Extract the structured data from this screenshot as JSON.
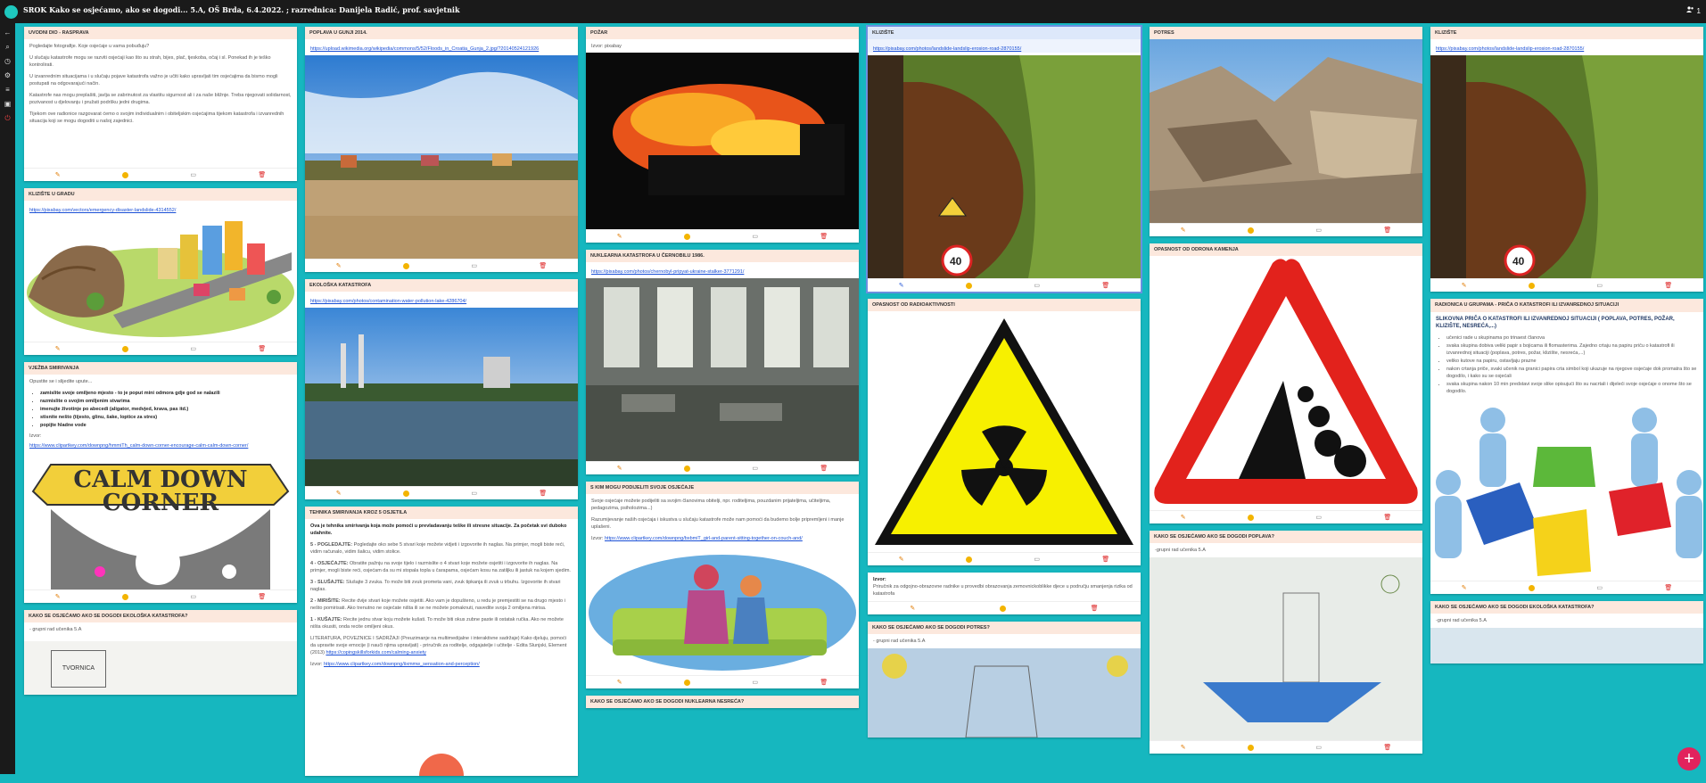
{
  "header": {
    "title": "SROK Kako se osjećamo, ako se dogodi... 5.A, OŠ Brda, 6.4.2022. ; razrednica: Danijela Radić, prof. savjetnik",
    "member_count": "1"
  },
  "sidebar": {
    "icons": [
      "back-arrow-icon",
      "search-icon",
      "clock-icon",
      "settings-icon",
      "sort-icon",
      "layout-icon",
      "power-icon"
    ]
  },
  "cards": {
    "uvodni": {
      "title": "UVODNI DIO - RASPRAVA",
      "p1": "Pogledajte fotografije. Koje osjećaje u vama pobuđuju?",
      "p2": "U slučaju katastrofe mogu se razviti osjećaji kao što su strah, bijes, plač, tjeskoba, očaj i sl. Ponekad ih je teško kontrolirati.",
      "p3": "U izvanrednim situacijama i u slučaju pojave katastrofa važno je učiti kako upravljati tim osjećajima da bismo mogli postupati na odgovarajući način.",
      "p4": "Katastrofe nas mogu preplašiti, javlja se zabrinutost za vlastitu sigurnost ali i za naše bližnje. Treba njegovati solidarnost, pozivanost u djelovanju i pružati podršku jedni drugima.",
      "p5": "Tijekom ove radionice razgovarat ćemo o svojim individualnim i obiteljskim osjećajima tijekom katastrofa i izvanrednih situacija koji se mogu dogoditi u našoj zajednici."
    },
    "kliziste_gradu": {
      "title": "KLIZIŠTE U GRADU",
      "link": "https://pixabay.com/vectors/emergency-disaster-landslide-4314552/"
    },
    "vjezba": {
      "title": "VJEŽBA SMIRIVANJA",
      "intro": "Opustite se i slijedite upute...",
      "items": [
        "zamislite svoje omiljeno mjesto - to je poput mini odmora gdje god se nalazili",
        "razmislite o svojim omiljenim stvarima",
        "imenujte životinje po abecedi (aligator, medvjed, krava, pas itd.)",
        "stisnite nešto (tijesto, glinu, šake, loptice za stres)",
        "popijte hladne vode"
      ],
      "source_label": "Izvor:",
      "source_link": "https://www.clipartkey.com/downpng/hmmiTh_calm-down-corner-encourage-calm-calm-down-corner/",
      "image_text": "CALM DOWN CORNER"
    },
    "ekoloska_grupe_1": {
      "title": "KAKO SE OSJEĆAMO AKO SE DOGODI EKOLOŠKA KATASTROFA?",
      "text": "- grupni rad učenika 5.A",
      "image_text": "TVORNICA"
    },
    "poplava": {
      "title": "POPLAVA U GUNJI 2014.",
      "link": "https://upload.wikimedia.org/wikipedia/commons/5/52/Floods_in_Croatia_Gunja_2.jpg/?20140524121926"
    },
    "ekoloska_katastrofa": {
      "title": "EKOLOŠKA KATASTROFA",
      "link": "https://pixabay.com/photos/contamination-water-pollution-lake-4286704/"
    },
    "tehnika": {
      "title": "TEHNIKA SMIRIVANJA KROZ 5 OSJETILA",
      "intro": "Ova je tehnika smirivanja koja može pomoći u prevladavanju teške ili stresne situacije. Za početak svi duboko udahnite.",
      "steps": [
        {
          "label": "5 - POGLEDAJTE:",
          "text": "Pogledajte oko sebe 5 stvari koje možete vidjeti i izgovorite ih naglas. Na primjer, mogli biste reći, vidim računalo, vidim šalicu, vidim stolice."
        },
        {
          "label": "4 - OSJEĆAJTE:",
          "text": "Obratite pažnju na svoje tijelo i razmislite o 4 stvari koje možete osjetiti i izgovorite ih naglas. Na primjer, mogli biste reći, osjećam da su mi stopala topla u čarapama, osjećam kosu na zatiljku ili jastuk na kojem sjedim."
        },
        {
          "label": "3 - SLUŠAJTE:",
          "text": "Slušajte 3 zvuka. To može biti zvuk prometa vani, zvuk tipkanja ili zvuk u trbuhu. Izgovorite ih stvari naglas."
        },
        {
          "label": "2 - MIRIŠITE:",
          "text": "Recite dvije stvari koje možete osjetiti. Ako vam je dopušteno, u redu je premjestiti se na drugo mjesto i nešto pomirisati. Ako trenutno ne osjećate ništa ili se ne možete pomaknuti, navedite svoja 2 omiljena mirisa."
        },
        {
          "label": "1 - KUŠAJTE:",
          "text": "Recite jednu stvar koju možete kušati. To može biti okus zubne paste ili ostatak ručka. Ako ne možete ništa okusiti, onda recite omiljeni okus."
        }
      ],
      "lit": "LITERATURA, POVEZNICE I SADRŽAJI (Preuzimanje na multimedijalne i interaktivne sadržaje) Kako djeluju, pomoći da upravite svoje emocije (i nauči njima upravljati) - priručnik za roditelje, odgajatelje i učitelje - Edita Slunjski, Element (2013)",
      "lit_link": "https://copingskillsforkids.com/calming-anxiety",
      "source_label": "Izvor:",
      "source_link": "https://www.clipartkey.com/downpng/iixmmw_sensation-and-perception/"
    },
    "pozar": {
      "title": "POŽAR",
      "text": "Izvor: pixabay"
    },
    "nuklearna": {
      "title": "NUKLEARNA KATASTROFA U ČERNOBILU 1986.",
      "link": "https://pixabay.com/photos/chernobyl-pripyat-ukraine-stalker-3771291/"
    },
    "s_kim": {
      "title": "S KIM MOGU PODIJELITI SVOJE OSJEĆAJE",
      "p1": "Svoje osjećaje možete podijeliti sa svojim članovima obitelji, npr. roditeljima, pouzdanim prijateljima, učiteljima, pedagozima, psiholozima...)",
      "p2": "Razumijevanje naših osjećaja i iskustva u slučaju katastrofe može nam pomoći da budemo bolje pripremljeni i manje uplašeni.",
      "source_label": "Izvor:",
      "source_link": "https://www.clipartkey.com/downpng/bxbmiT_girl-and-parent-sitting-together-on-couch-and/"
    },
    "nuklearna_grupe": {
      "title": "KAKO SE OSJEĆAMO AKO SE DOGODI NUKLEARNA NESREĆA?"
    },
    "kliziste_1": {
      "title": "KLIZIŠTE",
      "link": "https://pixabay.com/photos/landslide-landslip-erosion-road-2870155/"
    },
    "radioaktivnost": {
      "title": "OPASNOST OD RADIOAKTIVNOSTI"
    },
    "izvor_prirucnik": {
      "label": "Izvor:",
      "text": "Priručnik za odgojno-obrazovne radnike u provedbi obrazovanja zemovnickoblikke djece u području smanjenja rizika od katastrofa"
    },
    "potres_grupe": {
      "title": "KAKO SE OSJEĆAMO AKO SE DOGODI POTRES?",
      "text": "- grupni rad učenika 5.A"
    },
    "potres": {
      "title": "POTRES"
    },
    "odron": {
      "title": "OPASNOST OD ODRONA KAMENJA"
    },
    "poplava_grupe": {
      "title": "KAKO SE OSJEĆAMO AKO SE DOGODI POPLAVA?",
      "text": "-grupni rad učenika 5.A"
    },
    "kliziste_2": {
      "title": "KLIZIŠTE",
      "link": "https://pixabay.com/photos/landslide-landslip-erosion-road-2870155/"
    },
    "radionica": {
      "title": "RADIONICA U GRUPAMA - PRIČA O KATASTROFI ILI IZVANREDNOJ SITUACIJI",
      "heading": "SLIKOVNA PRIČA O KATASTROFI ILI IZVANREDNOJ SITUACIJI ( POPLAVA, POTRES, POŽAR, KLIZIŠTE, NESREĆA,...)",
      "items": [
        "učenici rade u skupinama po trinaest članova",
        "svaka skupina dobiva veliki papir s bojicama ili flomasterima. Zajedno crtaju na papiru priču o katastrofi ili izvanrednoj situaciji (poplava, potres, požar, klizište, nesreća,...)",
        "veliko kutove na papiru, ostavljaju prazne",
        "nakon crtanja priče, svaki učenik na granici papira crta simbol koji ukazuje na njegove osjećaje dok promatra što se dogodilo, i kako su se osjećali",
        "svaka skupina nakon 10 min predstavi svoje slike opisujući što su nacrtali i dijeleći svoje osjećaje o onome što se dogodilo."
      ]
    },
    "ekoloska_grupe_2": {
      "title": "KAKO SE OSJEĆAMO AKO SE DOGODI EKOLOŠKA KATASTROFA?",
      "text": "-grupni rad učenika 5.A"
    }
  },
  "colors": {
    "background": "#16b7bf",
    "card_header": "#fce8dd",
    "card_header_active": "#dde8fa",
    "link": "#1a4fd6",
    "fab": "#e2225d"
  },
  "fab_label": "+"
}
